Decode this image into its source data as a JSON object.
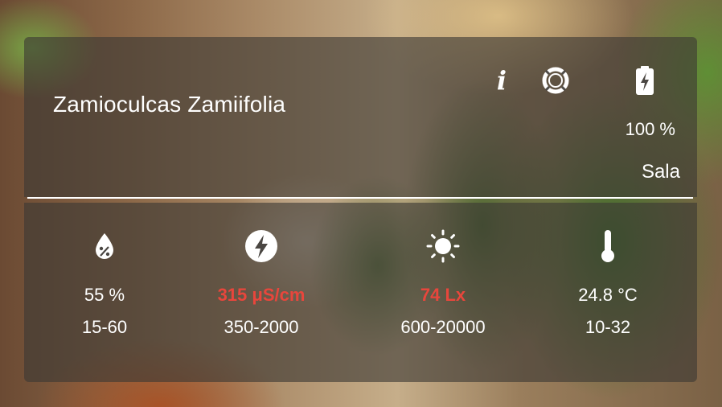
{
  "plant": {
    "name": "Zamioculcas Zamiifolia"
  },
  "header_icons": {
    "info": {
      "icon": "info-icon",
      "glyph": "i"
    },
    "help": {
      "icon": "lifebuoy-icon"
    },
    "battery": {
      "icon": "battery-charging-icon",
      "level": 100
    }
  },
  "status": {
    "battery_text": "100 %",
    "room": "Sala"
  },
  "metrics": [
    {
      "id": "moisture",
      "icon": "water-drop-percent-icon",
      "value": "55 %",
      "range": "15-60",
      "alert": false
    },
    {
      "id": "conductivity",
      "icon": "lightning-bolt-icon",
      "value": "315 μS/cm",
      "range": "350-2000",
      "alert": true
    },
    {
      "id": "light",
      "icon": "sun-icon",
      "value": "74 Lx",
      "range": "600-20000",
      "alert": true
    },
    {
      "id": "temperature",
      "icon": "thermometer-icon",
      "value": "24.8 °C",
      "range": "10-32",
      "alert": false
    }
  ],
  "colors": {
    "alert": "#e8463c",
    "panel": "#3c3834",
    "text": "#ffffff"
  }
}
